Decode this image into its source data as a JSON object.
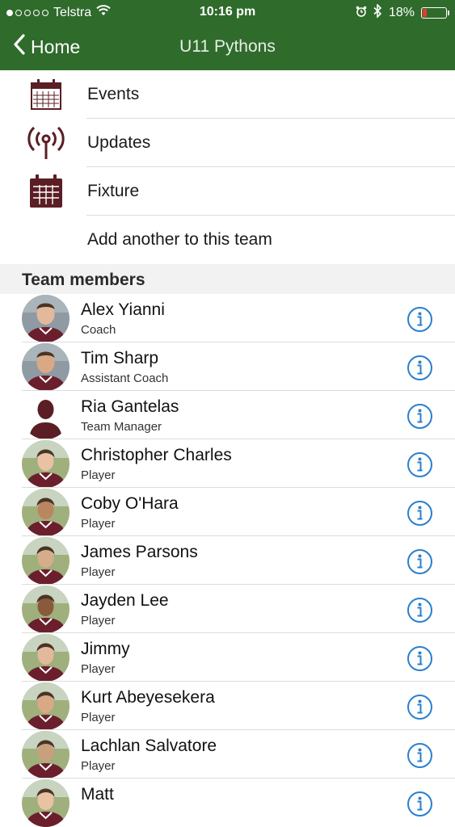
{
  "status": {
    "carrier": "Telstra",
    "time": "10:16 pm",
    "battery": "18%",
    "battery_level": 0.18,
    "signal_bars_filled": 1,
    "signal_bars_total": 5
  },
  "nav": {
    "back_label": "Home",
    "title": "U11 Pythons"
  },
  "menu": [
    {
      "label": "Events",
      "icon": "calendar-outline-icon"
    },
    {
      "label": "Updates",
      "icon": "broadcast-icon"
    },
    {
      "label": "Fixture",
      "icon": "calendar-filled-icon"
    },
    {
      "label": "Add another to this team",
      "icon": ""
    }
  ],
  "section": {
    "title": "Team members"
  },
  "members": [
    {
      "name": "Alex Yianni",
      "role": "Coach",
      "avatar": "photo-adult"
    },
    {
      "name": "Tim Sharp",
      "role": "Assistant Coach",
      "avatar": "photo-adult"
    },
    {
      "name": "Ria Gantelas",
      "role": "Team Manager",
      "avatar": "silhouette"
    },
    {
      "name": "Christopher Charles",
      "role": "Player",
      "avatar": "photo-child"
    },
    {
      "name": "Coby O'Hara",
      "role": "Player",
      "avatar": "photo-child"
    },
    {
      "name": "James Parsons",
      "role": "Player",
      "avatar": "photo-child"
    },
    {
      "name": "Jayden Lee",
      "role": "Player",
      "avatar": "photo-child"
    },
    {
      "name": "Jimmy",
      "role": "Player",
      "avatar": "photo-child"
    },
    {
      "name": "Kurt Abeyesekera",
      "role": "Player",
      "avatar": "photo-child"
    },
    {
      "name": "Lachlan Salvatore",
      "role": "Player",
      "avatar": "photo-child"
    },
    {
      "name": "Matt",
      "role": "",
      "avatar": "photo-child"
    }
  ],
  "colors": {
    "header_green": "#2f6b2b",
    "icon_maroon": "#5a1e24",
    "info_blue": "#2a7fcf",
    "jersey_maroon": "#6b1f2c"
  }
}
